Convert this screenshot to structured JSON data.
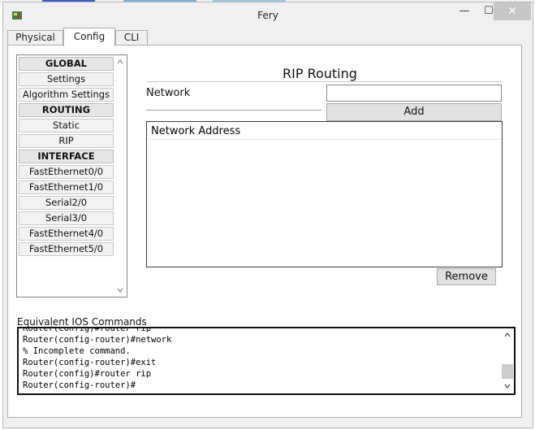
{
  "window": {
    "title": "Fery",
    "minimize_glyph": "—",
    "maximize_glyph": "☐",
    "close_glyph": "✕"
  },
  "tabs": [
    {
      "label": "Physical",
      "active": false
    },
    {
      "label": "Config",
      "active": true
    },
    {
      "label": "CLI",
      "active": false
    }
  ],
  "sidebar": {
    "items": [
      {
        "label": "GLOBAL",
        "header": true
      },
      {
        "label": "Settings",
        "header": false
      },
      {
        "label": "Algorithm Settings",
        "header": false
      },
      {
        "label": "ROUTING",
        "header": true
      },
      {
        "label": "Static",
        "header": false
      },
      {
        "label": "RIP",
        "header": false
      },
      {
        "label": "INTERFACE",
        "header": true
      },
      {
        "label": "FastEthernet0/0",
        "header": false
      },
      {
        "label": "FastEthernet1/0",
        "header": false
      },
      {
        "label": "Serial2/0",
        "header": false
      },
      {
        "label": "Serial3/0",
        "header": false
      },
      {
        "label": "FastEthernet4/0",
        "header": false
      },
      {
        "label": "FastEthernet5/0",
        "header": false
      }
    ]
  },
  "rip": {
    "section_title": "RIP Routing",
    "network_label": "Network",
    "network_value": "",
    "add_label": "Add",
    "list_header": "Network Address",
    "remove_label": "Remove"
  },
  "ios": {
    "label": "Equivalent IOS Commands",
    "lines": [
      "Router(config)#router rip",
      "Router(config-router)#network",
      "% Incomplete command.",
      "Router(config-router)#exit",
      "Router(config)#router rip",
      "Router(config-router)#"
    ]
  },
  "colors": {
    "close_button": "#c7c7c7",
    "panel_bg": "#ffffff",
    "window_bg": "#f0f0f0"
  },
  "icons": [
    "app-icon",
    "minimize-icon",
    "maximize-icon",
    "close-icon",
    "scroll-up-icon",
    "scroll-down-icon"
  ]
}
